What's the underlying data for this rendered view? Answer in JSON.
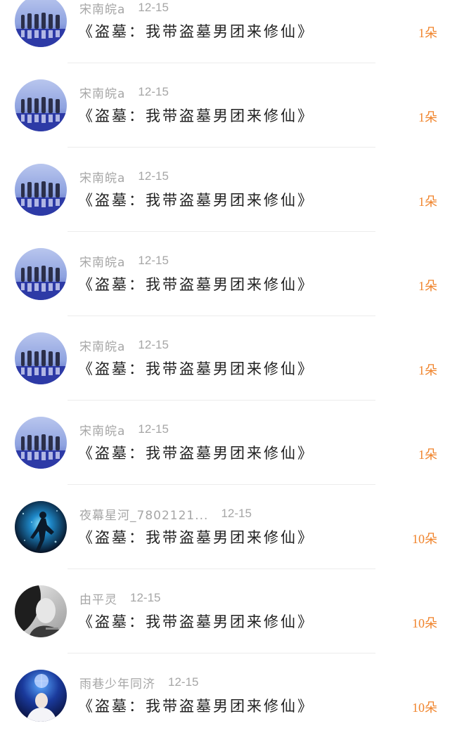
{
  "gift_list": {
    "items": [
      {
        "user": "宋南皖a",
        "date": "12-15",
        "title": "《盗墓：我带盗墓男团来修仙》",
        "amount": "1朵",
        "avatar_icon": "group-silhouette-avatar"
      },
      {
        "user": "宋南皖a",
        "date": "12-15",
        "title": "《盗墓：我带盗墓男团来修仙》",
        "amount": "1朵",
        "avatar_icon": "group-silhouette-avatar"
      },
      {
        "user": "宋南皖a",
        "date": "12-15",
        "title": "《盗墓：我带盗墓男团来修仙》",
        "amount": "1朵",
        "avatar_icon": "group-silhouette-avatar"
      },
      {
        "user": "宋南皖a",
        "date": "12-15",
        "title": "《盗墓：我带盗墓男团来修仙》",
        "amount": "1朵",
        "avatar_icon": "group-silhouette-avatar"
      },
      {
        "user": "宋南皖a",
        "date": "12-15",
        "title": "《盗墓：我带盗墓男团来修仙》",
        "amount": "1朵",
        "avatar_icon": "group-silhouette-avatar"
      },
      {
        "user": "宋南皖a",
        "date": "12-15",
        "title": "《盗墓：我带盗墓男团来修仙》",
        "amount": "1朵",
        "avatar_icon": "group-silhouette-avatar"
      },
      {
        "user": "夜幕星河_7802121...",
        "date": "12-15",
        "title": "《盗墓：我带盗墓男团来修仙》",
        "amount": "10朵",
        "avatar_icon": "blue-figure-avatar"
      },
      {
        "user": "由平灵",
        "date": "12-15",
        "title": "《盗墓：我带盗墓男团来修仙》",
        "amount": "10朵",
        "avatar_icon": "grayscale-portrait-avatar"
      },
      {
        "user": "雨巷少年同济",
        "date": "12-15",
        "title": "《盗墓：我带盗墓男团来修仙》",
        "amount": "10朵",
        "avatar_icon": "disco-portrait-avatar"
      }
    ]
  },
  "colors": {
    "amount": "#f0842c",
    "meta_text": "#a6a6a6",
    "title_text": "#222222",
    "divider": "#ececec"
  }
}
